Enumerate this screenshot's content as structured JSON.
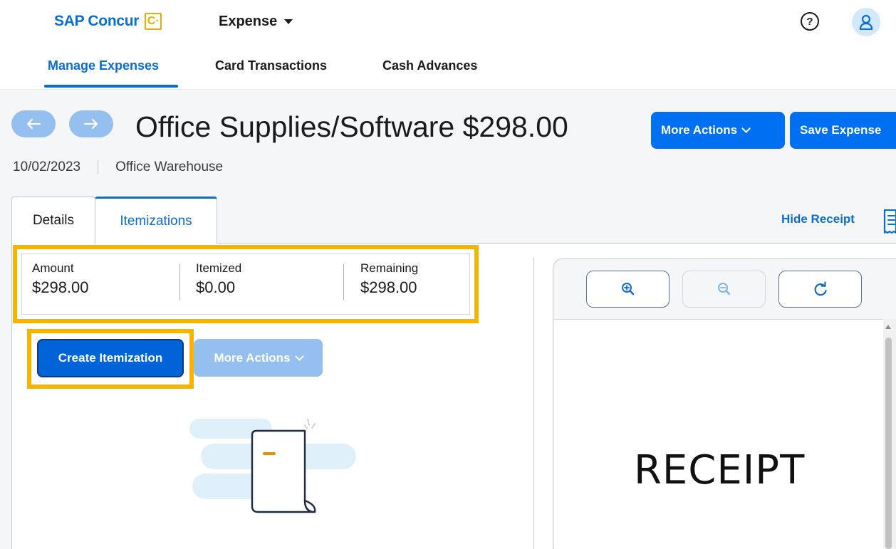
{
  "header": {
    "brand": "SAP Concur",
    "brand_mark": "C·",
    "app_switcher": "Expense",
    "help_icon": "help-circle-icon",
    "avatar_icon": "user-icon"
  },
  "nav": {
    "tabs": [
      {
        "label": "Manage Expenses",
        "active": true
      },
      {
        "label": "Card Transactions",
        "active": false
      },
      {
        "label": "Cash Advances",
        "active": false
      }
    ]
  },
  "expense": {
    "title": "Office Supplies/Software $298.00",
    "date": "10/02/2023",
    "vendor": "Office Warehouse",
    "more_actions_label": "More Actions",
    "save_label": "Save Expense"
  },
  "tabs": {
    "details": "Details",
    "itemizations": "Itemizations",
    "active": "Itemizations"
  },
  "receipt_toggle": {
    "label": "Hide Receipt",
    "icon": "receipt-icon"
  },
  "summary": {
    "amount_label": "Amount",
    "amount_value": "$298.00",
    "itemized_label": "Itemized",
    "itemized_value": "$0.00",
    "remaining_label": "Remaining",
    "remaining_value": "$298.00"
  },
  "itemization_actions": {
    "create_label": "Create Itemization",
    "more_actions_label": "More Actions"
  },
  "viewer": {
    "zoom_in_icon": "zoom-in-icon",
    "zoom_out_icon": "zoom-out-icon",
    "rotate_icon": "rotate-icon",
    "receipt_text": "RECEIPT"
  },
  "colors": {
    "accent": "#0a6ed1",
    "primary_button": "#0070f2",
    "disabled_button": "#94bfee",
    "highlight": "#f5b400"
  }
}
